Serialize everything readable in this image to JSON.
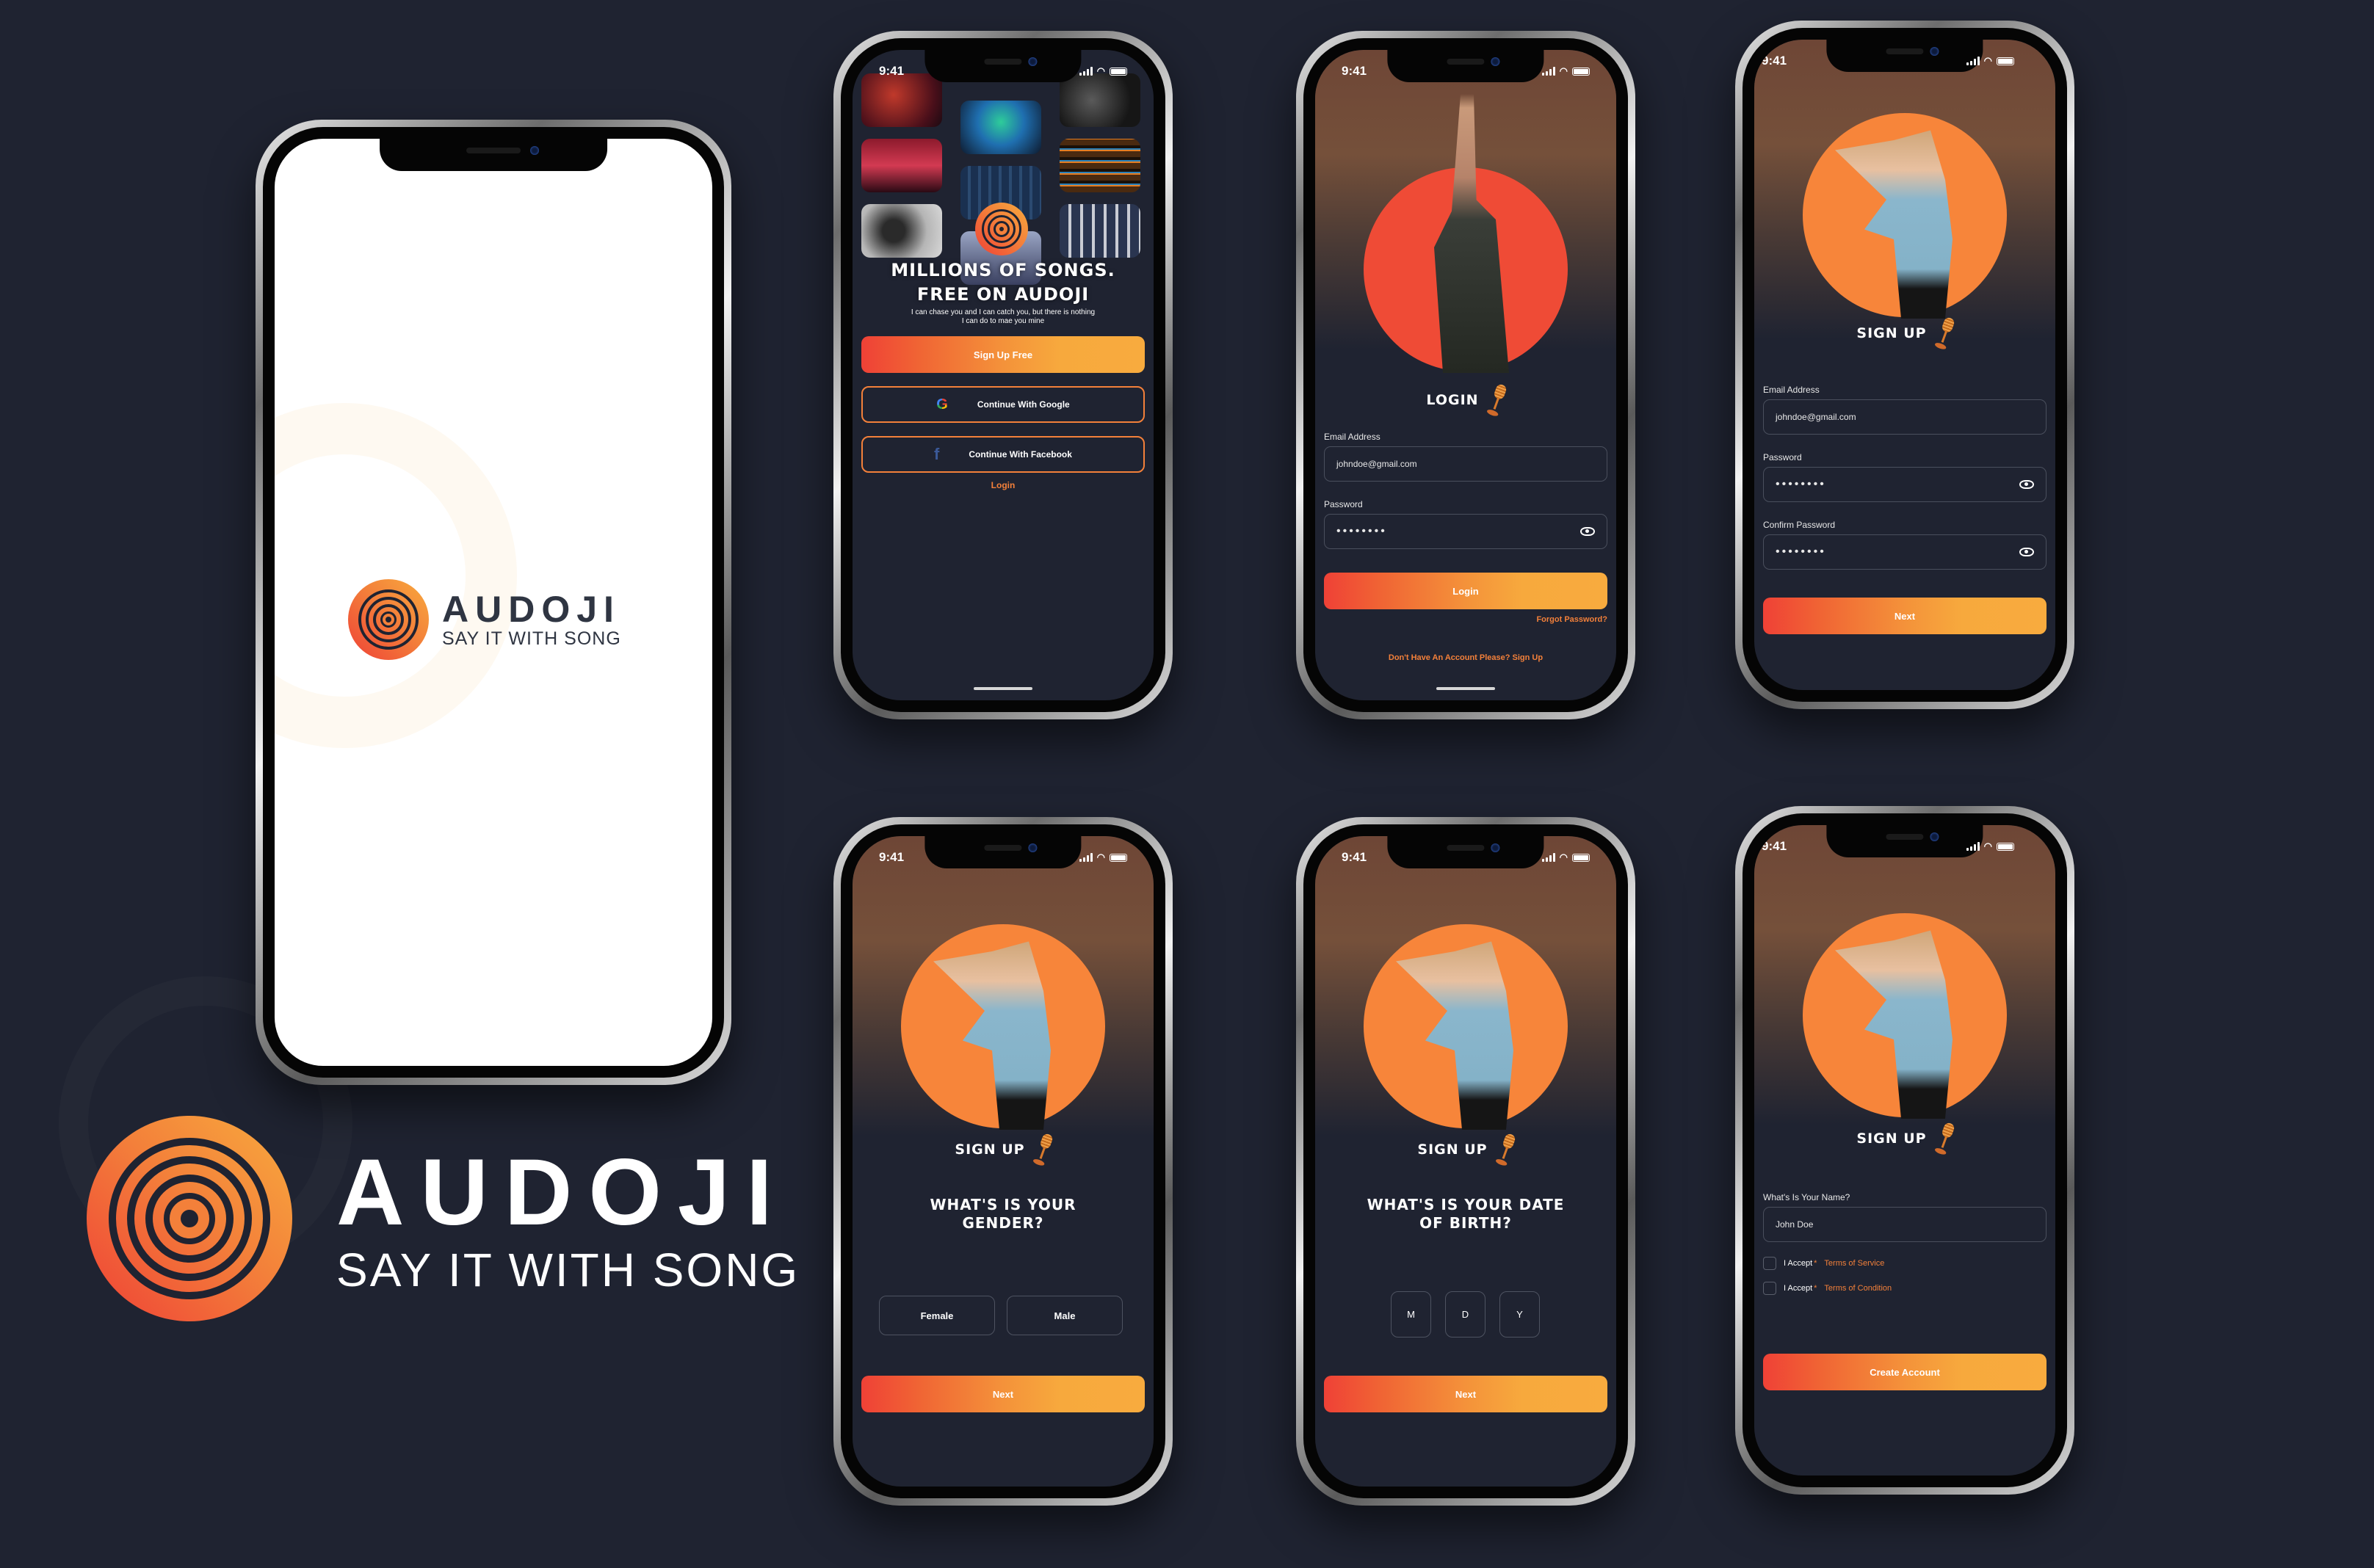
{
  "brand": {
    "name": "AUDOJI",
    "tagline": "SAY IT WITH SONG",
    "colors": {
      "background": "#1f2331",
      "accent_red": "#ef4136",
      "accent_orange": "#f3803a",
      "accent_yellow": "#f8ab3e",
      "hero_red_circle": "#ef4b36",
      "hero_orange_circle": "#f7853a"
    }
  },
  "status_bar": {
    "time": "9:41"
  },
  "splash": {
    "brand_name": "AUDOJI",
    "tagline": "SAY IT WITH SONG"
  },
  "welcome": {
    "headline_line1": "MILLIONS OF SONGS.",
    "headline_line2": "FREE ON AUDOJI",
    "subtitle_line1": "I can chase you and I can catch you, but there is nothing",
    "subtitle_line2": "I can do to mae you mine",
    "signup_button": "Sign Up Free",
    "google_button": "Continue With Google",
    "facebook_button": "Continue With Facebook",
    "login_link": "Login",
    "photos": [
      "concert-singer",
      "crowd-lights",
      "guitarist-bw",
      "crowd-hands-red",
      "mixing-console-blue",
      "mixer-leds",
      "headphones-sheet-music",
      "crowd-hands",
      "mixing-faders"
    ]
  },
  "login": {
    "title": "LOGIN",
    "email_label": "Email Address",
    "email_value": "johndoe@gmail.com",
    "password_label": "Password",
    "password_value": "••••••••",
    "login_button": "Login",
    "forgot_link": "Forgot Password?",
    "signup_prompt": "Don't Have An Account Please? Sign Up"
  },
  "signup_credentials": {
    "title": "SIGN UP",
    "email_label": "Email Address",
    "email_value": "johndoe@gmail.com",
    "password_label": "Password",
    "password_value": "••••••••",
    "confirm_label": "Confirm Password",
    "confirm_value": "••••••••",
    "next_button": "Next"
  },
  "signup_gender": {
    "title": "SIGN UP",
    "question_line1": "WHAT'S IS YOUR",
    "question_line2": "GENDER?",
    "options": [
      "Female",
      "Male"
    ],
    "next_button": "Next"
  },
  "signup_dob": {
    "title": "SIGN UP",
    "question_line1": "WHAT'S IS YOUR DATE",
    "question_line2": "OF BIRTH?",
    "fields": [
      "M",
      "D",
      "Y"
    ],
    "next_button": "Next"
  },
  "signup_name": {
    "title": "SIGN UP",
    "name_label": "What's Is Your Name?",
    "name_value": "John Doe",
    "accept_label": "I Accept",
    "required_mark": "*",
    "terms_service": "Terms of Service",
    "terms_condition": "Terms of Condition",
    "create_button": "Create Account"
  }
}
